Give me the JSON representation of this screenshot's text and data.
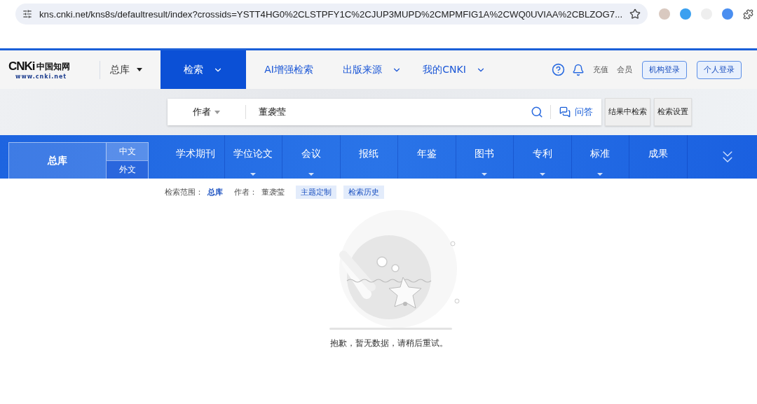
{
  "browser": {
    "url": "kns.cnki.net/kns8s/defaultresult/index?crossids=YSTT4HG0%2CLSTPFY1C%2CJUP3MUPD%2CMPMFIG1A%2CWQ0UVIAA%2CBLZOG7..."
  },
  "header": {
    "logo": {
      "mark": "CNKi",
      "name": "中国知网",
      "domain": "www.cnki.net"
    },
    "database": "总库",
    "nav": [
      {
        "label": "检索",
        "selected": true,
        "dropdown": true
      },
      {
        "label": "AI增强检索",
        "selected": false,
        "dropdown": false
      },
      {
        "label": "出版来源",
        "selected": false,
        "dropdown": true
      },
      {
        "label": "我的CNKI",
        "selected": false,
        "dropdown": true
      }
    ],
    "links": [
      "充值",
      "会员"
    ],
    "buttons": [
      "机构登录",
      "个人登录"
    ]
  },
  "search": {
    "field": "作者",
    "value": "董袭莹",
    "qa": "问答",
    "buttons": [
      "结果中检索",
      "检索设置"
    ]
  },
  "categories": {
    "main": "总库",
    "languages": [
      {
        "label": "中文",
        "selected": true
      },
      {
        "label": "外文",
        "selected": false
      }
    ],
    "items": [
      {
        "label": "学术期刊",
        "dropdown": false
      },
      {
        "label": "学位论文",
        "dropdown": true
      },
      {
        "label": "会议",
        "dropdown": true
      },
      {
        "label": "报纸",
        "dropdown": false
      },
      {
        "label": "年鉴",
        "dropdown": false
      },
      {
        "label": "图书",
        "dropdown": true
      },
      {
        "label": "专利",
        "dropdown": true
      },
      {
        "label": "标准",
        "dropdown": true
      },
      {
        "label": "成果",
        "dropdown": false
      }
    ]
  },
  "filters": {
    "scope_label": "检索范围：",
    "scope": "总库",
    "author_label": "作者：",
    "author": "董袭莹",
    "tags": [
      "主题定制",
      "检索历史"
    ]
  },
  "empty": {
    "message": "抱歉，暂无数据，请稍后重试。"
  }
}
